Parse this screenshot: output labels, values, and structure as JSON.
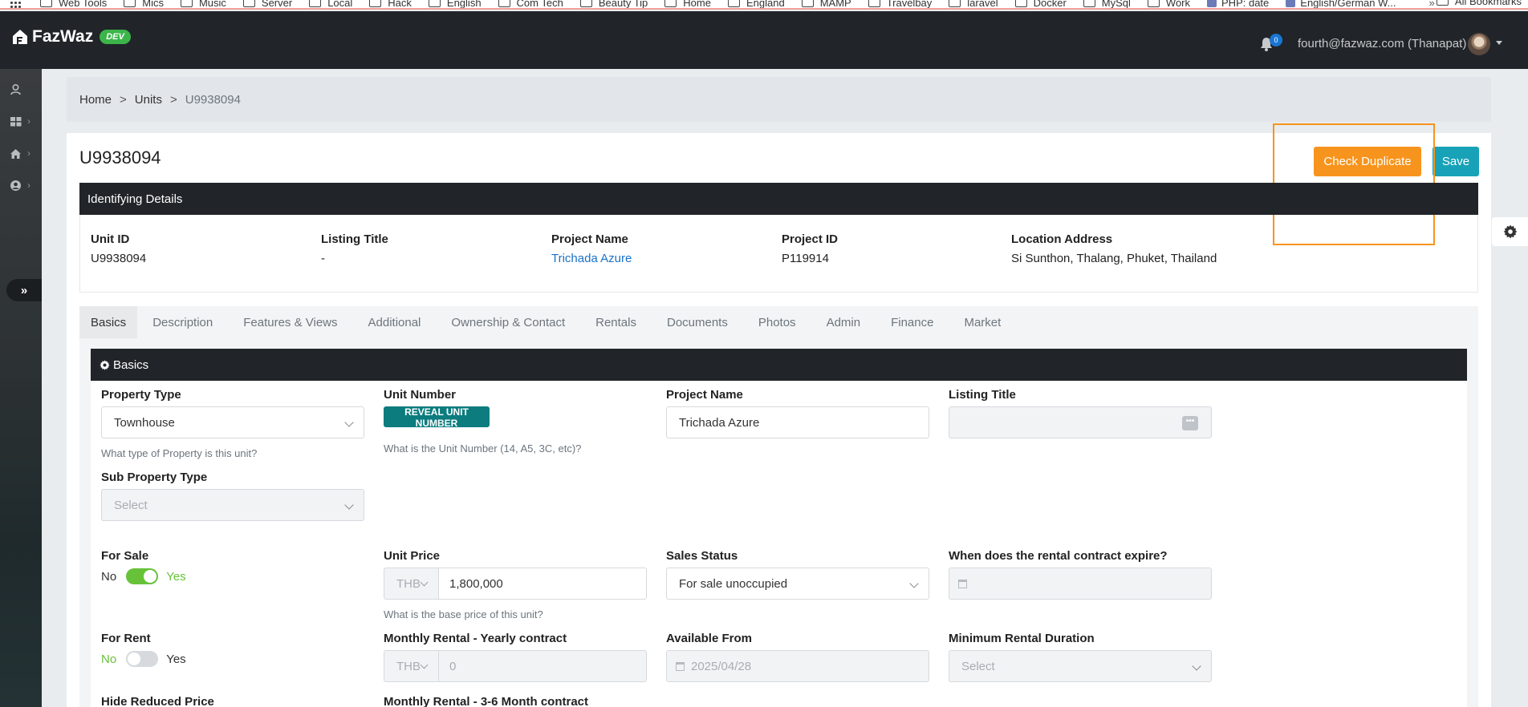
{
  "bookmarks": {
    "items": [
      "Web Tools",
      "Mics",
      "Music",
      "Server",
      "Local",
      "Hack",
      "English",
      "Com Tech",
      "Beauty Tip",
      "Home",
      "England",
      "MAMP",
      "Travelbay",
      "laravel",
      "Docker",
      "MySql",
      "Work"
    ],
    "php_item": "PHP: date",
    "english_german": "English/German W...",
    "more": "»",
    "all_bookmarks": "All Bookmarks"
  },
  "header": {
    "logo_text": "FazWaz",
    "env_badge": "DEV",
    "notification_count": "0",
    "user": "fourth@fazwaz.com (Thanapat)"
  },
  "sidebar": {
    "toggle_label": "»"
  },
  "breadcrumb": {
    "home": "Home",
    "units": "Units",
    "current": "U9938094",
    "sep": ">"
  },
  "page": {
    "title": "U9938094",
    "check_duplicate": "Check Duplicate",
    "save": "Save"
  },
  "identifying": {
    "title": "Identifying Details",
    "unit_id_label": "Unit ID",
    "unit_id": "U9938094",
    "listing_title_label": "Listing Title",
    "listing_title": "-",
    "project_name_label": "Project Name",
    "project_name": "Trichada Azure",
    "project_id_label": "Project ID",
    "project_id": "P119914",
    "location_label": "Location Address",
    "location": "Si Sunthon, Thalang, Phuket, Thailand"
  },
  "tabs": [
    "Basics",
    "Description",
    "Features & Views",
    "Additional",
    "Ownership & Contact",
    "Rentals",
    "Documents",
    "Photos",
    "Admin",
    "Finance",
    "Market"
  ],
  "basics": {
    "title": "Basics",
    "property_type_label": "Property Type",
    "property_type": "Townhouse",
    "property_type_help": "What type of Property is this unit?",
    "unit_number_label": "Unit Number",
    "reveal_button": "REVEAL UNIT NUMBER",
    "unit_number_help": "What is the Unit Number (14, A5, 3C, etc)?",
    "project_name_label": "Project Name",
    "project_name": "Trichada Azure",
    "listing_title_label": "Listing Title",
    "listing_title_dots": "•••",
    "sub_property_type_label": "Sub Property Type",
    "sub_property_type_placeholder": "Select",
    "for_sale_label": "For Sale",
    "for_sale_no": "No",
    "for_sale_yes": "Yes",
    "for_sale_on": true,
    "unit_price_label": "Unit Price",
    "unit_price_currency": "THB",
    "unit_price": "1,800,000",
    "unit_price_help": "What is the base price of this unit?",
    "sales_status_label": "Sales Status",
    "sales_status": "For sale unoccupied",
    "rental_expire_label": "When does the rental contract expire?",
    "for_rent_label": "For Rent",
    "for_rent_no": "No",
    "for_rent_yes": "Yes",
    "for_rent_on": false,
    "monthly_yearly_label": "Monthly Rental - Yearly contract",
    "monthly_yearly_currency": "THB",
    "monthly_yearly_value": "0",
    "available_from_label": "Available From",
    "available_from": "2025/04/28",
    "min_rental_label": "Minimum Rental Duration",
    "min_rental_placeholder": "Select",
    "hide_reduced_label": "Hide Reduced Price",
    "monthly_short_label": "Monthly Rental - 3-6 Month contract"
  },
  "colors": {
    "accent_orange": "#f7941d",
    "save_teal": "#17a2b8",
    "reveal_teal": "#0c7c7f",
    "toggle_green": "#67c23a",
    "link_blue": "#1a73c9"
  }
}
